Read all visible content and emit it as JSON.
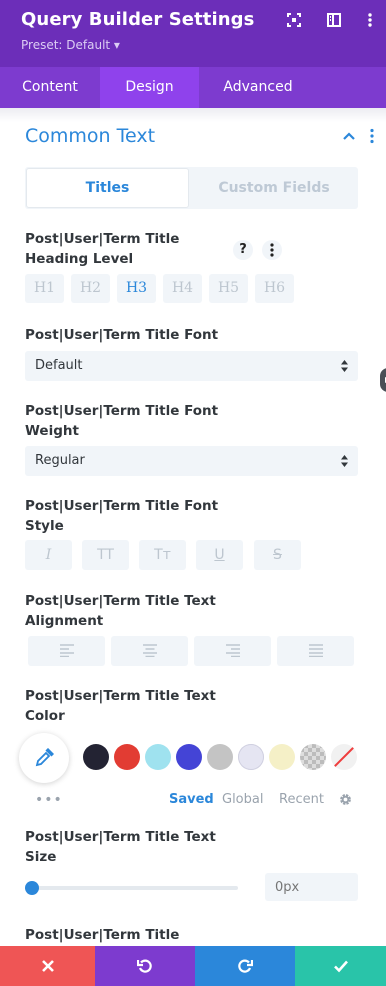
{
  "header": {
    "title": "Query Builder Settings",
    "preset": "Preset: Default ▾",
    "icons": [
      "expand-icon",
      "sidebar-toggle-icon"
    ],
    "colors": {
      "header_bg": "#6c2eb9",
      "tabs_bg": "#7d3bcf",
      "active_tab_bg": "#8f42ec"
    }
  },
  "tabs": [
    {
      "label": "Content",
      "active": false
    },
    {
      "label": "Design",
      "active": true
    },
    {
      "label": "Advanced",
      "active": false
    }
  ],
  "group": {
    "title": "Common Text",
    "subtabs": [
      {
        "label": "Titles",
        "active": true
      },
      {
        "label": "Custom Fields",
        "active": false
      }
    ]
  },
  "fields": {
    "heading_level": {
      "label_line1": "Post|User|Term Title",
      "label_line2": "Heading Level",
      "help_icon": "?",
      "options": [
        "H1",
        "H2",
        "H3",
        "H4",
        "H5",
        "H6"
      ],
      "selected": "H3"
    },
    "font": {
      "label": "Post|User|Term Title Font",
      "value": "Default"
    },
    "font_weight": {
      "label_line1": "Post|User|Term Title Font",
      "label_line2": "Weight",
      "value": "Regular"
    },
    "font_style": {
      "label_line1": "Post|User|Term Title Font",
      "label_line2": "Style",
      "buttons": [
        {
          "icon": "italic-icon",
          "glyph": "I"
        },
        {
          "icon": "uppercase-icon",
          "glyph": "TT"
        },
        {
          "icon": "capitalize-icon",
          "glyph": "Tᴛ"
        },
        {
          "icon": "underline-icon",
          "glyph": "U"
        },
        {
          "icon": "strikethrough-icon",
          "glyph": "S"
        }
      ]
    },
    "text_alignment": {
      "label_line1": "Post|User|Term Title Text",
      "label_line2": "Alignment",
      "buttons": [
        "align-left-icon",
        "align-center-icon",
        "align-right-icon",
        "align-justify-icon"
      ]
    },
    "text_color": {
      "label_line1": "Post|User|Term Title Text",
      "label_line2": "Color",
      "more": "•••",
      "swatches": [
        "#232333",
        "#e23c33",
        "#9fe2ef",
        "#4444d6",
        "#c4c4c4",
        "#e5e5f2",
        "#f5f0c7",
        "checkerboard",
        "none"
      ],
      "palette_tabs": [
        {
          "label": "Saved",
          "active": true
        },
        {
          "label": "Global",
          "active": false
        },
        {
          "label": "Recent",
          "active": false
        }
      ]
    },
    "text_size": {
      "label_line1": "Post|User|Term Title Text",
      "label_line2": "Size",
      "placeholder": "0px",
      "slider_fraction": 0
    },
    "letter_spacing": {
      "label": "Post|User|Term Title Letter"
    }
  },
  "footer": {
    "buttons": [
      {
        "icon": "close-icon",
        "color": "#ef5555"
      },
      {
        "icon": "undo-icon",
        "color": "#7d3bcf"
      },
      {
        "icon": "redo-icon",
        "color": "#2b87da"
      },
      {
        "icon": "check-icon",
        "color": "#29c4a9"
      }
    ]
  }
}
